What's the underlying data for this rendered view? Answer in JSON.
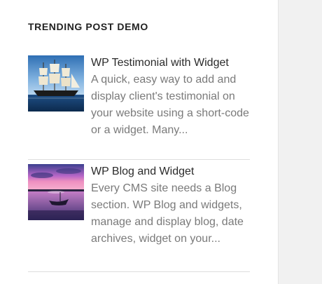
{
  "widget": {
    "title": "TRENDING POST DEMO",
    "posts": [
      {
        "title": "WP Testimonial with Widget",
        "excerpt": "A quick, easy way to add and display client's testimonial on your website using a short-code or a widget. Many..."
      },
      {
        "title": "WP Blog and Widget",
        "excerpt": "Every CMS site needs a Blog section. WP Blog and widgets, manage and display blog, date archives, widget on your..."
      }
    ]
  },
  "colors": {
    "title": "#222222",
    "post_title": "#2b2b2b",
    "excerpt": "#7a7a7a",
    "divider": "#dedede",
    "sidebar_bg": "#f1f1f1"
  },
  "icons": [
    "sailing-ship-thumbnail",
    "sunset-boat-thumbnail"
  ]
}
